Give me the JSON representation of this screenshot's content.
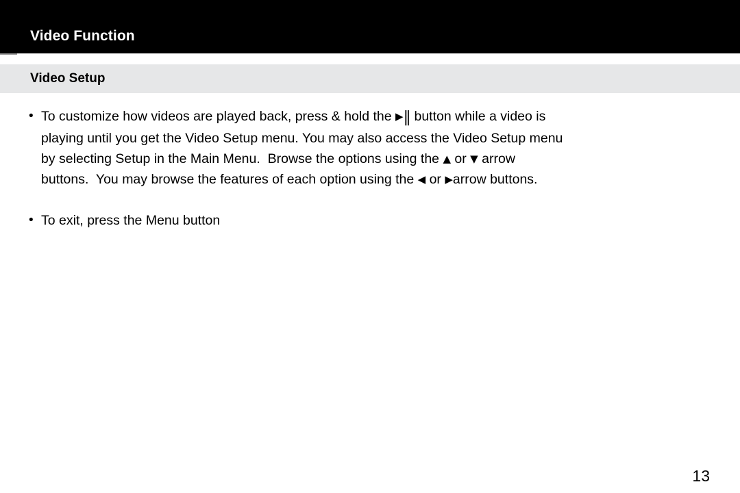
{
  "slide": {
    "title": "Video Function",
    "subtitle": "Video Setup",
    "page_number": "13",
    "colors": {
      "title_bar_bg": "#000000",
      "title_bar_text": "#ffffff",
      "subtitle_band_bg": "#e6e7e8",
      "subtitle_text": "#000000",
      "body_text": "#000000",
      "page_bg": "#ffffff",
      "nub": "#9d9d9d"
    }
  },
  "bullets": [
    {
      "marker": "•",
      "lines": [
        {
          "segments": [
            {
              "type": "text",
              "value": "To customize how videos are played back, press & hold the "
            },
            {
              "type": "glyph",
              "icon": "play-triangle-icon",
              "value": "▶"
            },
            {
              "type": "text",
              "value": ""
            },
            {
              "type": "glyph_pause",
              "icon": "pause-bars-icon",
              "value": "‖"
            },
            {
              "type": "text",
              "value": " button while a video is"
            }
          ]
        },
        {
          "segments": [
            {
              "type": "text",
              "value": "playing until you get the Video Setup menu. You may also access the Video Setup menu"
            }
          ]
        },
        {
          "segments": [
            {
              "type": "text",
              "value": "by selecting Setup in the Main Menu.  Browse the options using the "
            },
            {
              "type": "glyph",
              "icon": "up-triangle-icon",
              "value": "▲"
            },
            {
              "type": "text",
              "value": " or "
            },
            {
              "type": "glyph",
              "icon": "down-triangle-icon",
              "value": "▼"
            },
            {
              "type": "text",
              "value": " arrow"
            }
          ]
        },
        {
          "segments": [
            {
              "type": "text",
              "value": "buttons.  You may browse the features of each option using the "
            },
            {
              "type": "glyph",
              "icon": "left-triangle-icon",
              "value": "◀"
            },
            {
              "type": "text",
              "value": " or "
            },
            {
              "type": "glyph",
              "icon": "right-triangle-icon",
              "value": "▶"
            },
            {
              "type": "text",
              "value": "arrow buttons."
            }
          ]
        }
      ]
    },
    {
      "marker": "•",
      "lines": [
        {
          "segments": [
            {
              "type": "text",
              "value": "To exit, press the Menu button"
            }
          ]
        }
      ]
    }
  ]
}
